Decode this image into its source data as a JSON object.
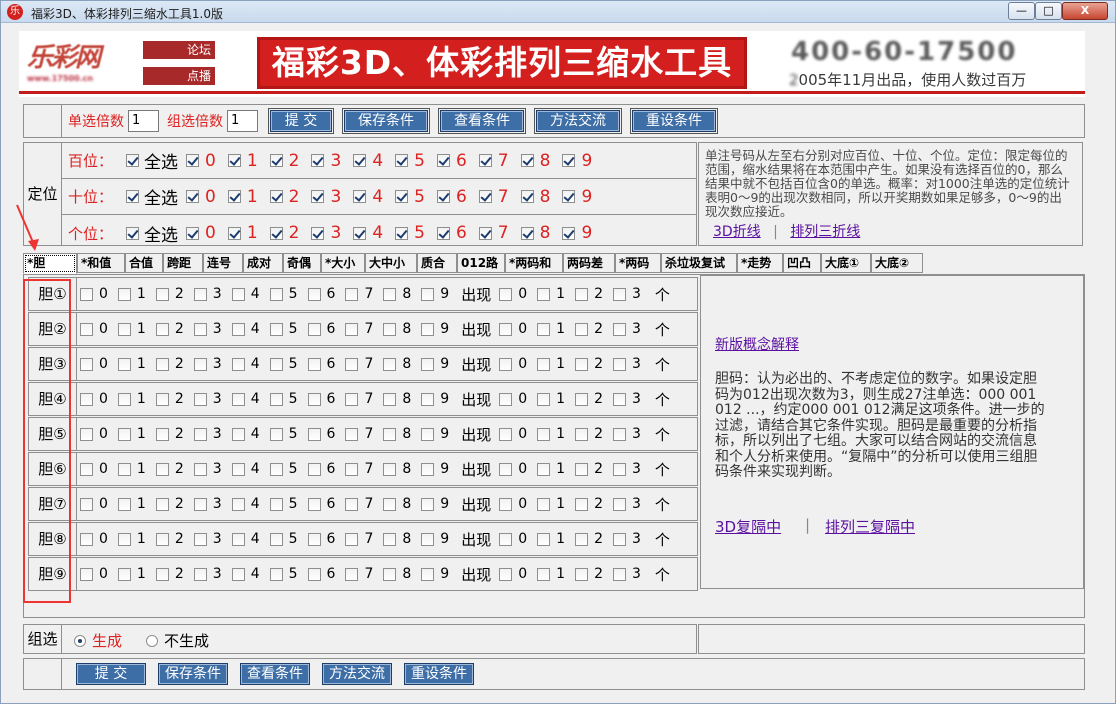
{
  "window": {
    "title": "福彩3D、体彩排列三缩水工具1.0版",
    "icon_label": "乐",
    "min_label": "—",
    "max_label": "□",
    "close_label": "X"
  },
  "header": {
    "logo_text": "乐彩网",
    "logo_sub": "www.17500.cn",
    "links": [
      "论坛",
      "点播"
    ],
    "banner": "福彩3D、体彩排列三缩水工具",
    "phone": "400-60-17500",
    "published_prefix": "2",
    "published_text": "005年11月出品，使用人数过百万"
  },
  "toolbar": {
    "single_label": "单选倍数",
    "single_value": "1",
    "group_label": "组选倍数",
    "group_value": "1",
    "buttons": [
      "提 交",
      "保存条件",
      "查看条件",
      "方法交流",
      "重设条件"
    ]
  },
  "position": {
    "title": "定位",
    "rows": [
      {
        "label": "百位：",
        "all": "全选"
      },
      {
        "label": "十位：",
        "all": "全选"
      },
      {
        "label": "个位：",
        "all": "全选"
      }
    ],
    "digits": [
      "0",
      "1",
      "2",
      "3",
      "4",
      "5",
      "6",
      "7",
      "8",
      "9"
    ],
    "description": "单注号码从左至右分别对应百位、十位、个位。定位：限定每位的范围，缩水结果将在本范围中产生。如果没有选择百位的0，那么结果中就不包括百位含0的单选。概率：对1000注单选的定位统计表明0～9的出现次数相同，所以开奖期数如果足够多，0～9的出现次数应接近。",
    "link1": "3D折线",
    "sep": "|",
    "link2": "排列三折线"
  },
  "tabs": [
    "*胆",
    "*和值",
    "合值",
    "跨距",
    "连号",
    "成对",
    "奇偶",
    "*大小",
    "大中小",
    "质合",
    "012路",
    "*两码和",
    "两码差",
    "*两码",
    "杀垃圾复试",
    "*走势",
    "凹凸",
    "大底①",
    "大底②"
  ],
  "dan": {
    "rows": [
      "胆①",
      "胆②",
      "胆③",
      "胆④",
      "胆⑤",
      "胆⑥",
      "胆⑦",
      "胆⑧",
      "胆⑨"
    ],
    "digits": [
      "0",
      "1",
      "2",
      "3",
      "4",
      "5",
      "6",
      "7",
      "8",
      "9"
    ],
    "appear_label": "出现",
    "counts": [
      "0",
      "1",
      "2",
      "3"
    ],
    "count_unit": "个"
  },
  "help": {
    "link_top": "新版概念解释",
    "text": "胆码：认为必出的、不考虑定位的数字。如果设定胆码为012出现次数为3，则生成27注单选：000 001 012 ...，约定000 001 012满足这项条件。进一步的过滤，请结合其它条件实现。胆码是最重要的分析指标，所以列出了七组。大家可以结合网站的交流信息和个人分析来使用。“复隔中”的分析可以使用三组胆码条件来实现判断。",
    "link1": "3D复隔中",
    "sep": "|",
    "link2": "排列三复隔中"
  },
  "group": {
    "label": "组选",
    "opt_generate": "生成",
    "opt_none": "不生成"
  },
  "bottom_buttons": [
    "提 交",
    "保存条件",
    "查看条件",
    "方法交流",
    "重设条件"
  ],
  "colors": {
    "accent_red": "#d41f1f",
    "button_blue": "#3e6ea6",
    "link_purple": "#5a10a0",
    "annotation_red": "#ee3333"
  }
}
